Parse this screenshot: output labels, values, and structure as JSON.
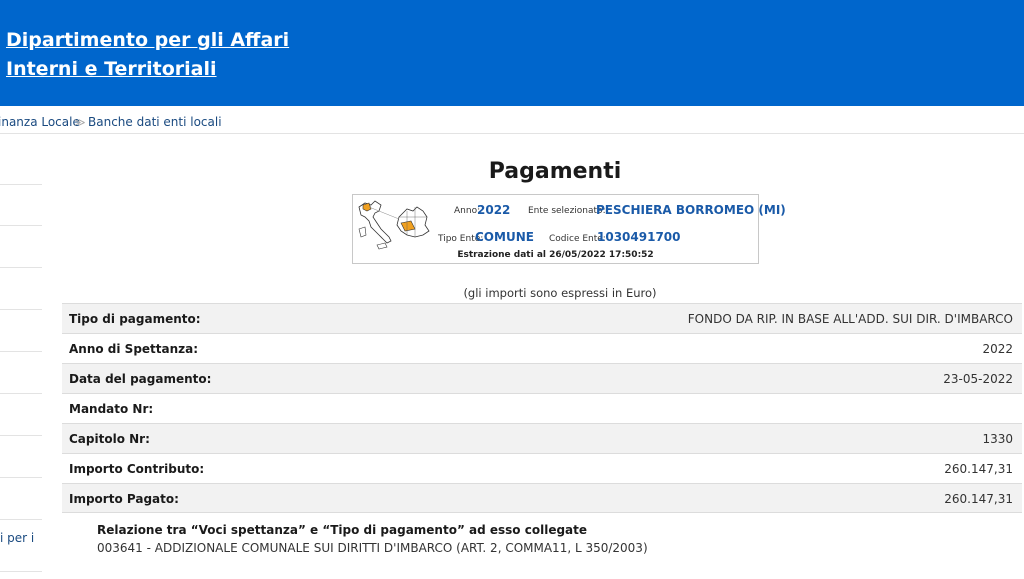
{
  "header": {
    "title_line1": "Dipartimento per gli Affari",
    "title_line2": "Interni e Territoriali"
  },
  "breadcrumb": [
    {
      "label": "inanza Locale"
    },
    {
      "label": "Banche dati enti locali"
    }
  ],
  "sidebar": {
    "partial_link": "i per i"
  },
  "page": {
    "title": "Pagamenti"
  },
  "info_box": {
    "anno_label": "Anno:",
    "anno_value": "2022",
    "ente_label": "Ente selezionato:",
    "ente_value": "PESCHIERA BORROMEO (MI)",
    "tipo_label": "Tipo Ente:",
    "tipo_value": "COMUNE",
    "codice_label": "Codice Ente:",
    "codice_value": "1030491700",
    "extraction": "Estrazione dati al 26/05/2022 17:50:52"
  },
  "note": "(gli importi sono espressi in Euro)",
  "rows": [
    {
      "label": "Tipo di pagamento:",
      "value": "FONDO DA RIP. IN BASE ALL'ADD. SUI DIR. D'IMBARCO"
    },
    {
      "label": "Anno di Spettanza:",
      "value": "2022"
    },
    {
      "label": "Data del pagamento:",
      "value": "23-05-2022"
    },
    {
      "label": "Mandato Nr:",
      "value": ""
    },
    {
      "label": "Capitolo Nr:",
      "value": "1330"
    },
    {
      "label": "Importo Contributo:",
      "value": "260.147,31"
    },
    {
      "label": "Importo Pagato:",
      "value": "260.147,31"
    }
  ],
  "relation": {
    "title": "Relazione tra “Voci spettanza” e “Tipo di pagamento” ad esso collegate",
    "value": "003641 - ADDIZIONALE COMUNALE SUI DIRITTI D'IMBARCO (ART. 2, COMMA11, L 350/2003)"
  },
  "colors": {
    "header_bg": "#0066cc",
    "link": "#1a4a80",
    "info_value": "#1a5aa8",
    "region_highlight": "#f0a020"
  }
}
